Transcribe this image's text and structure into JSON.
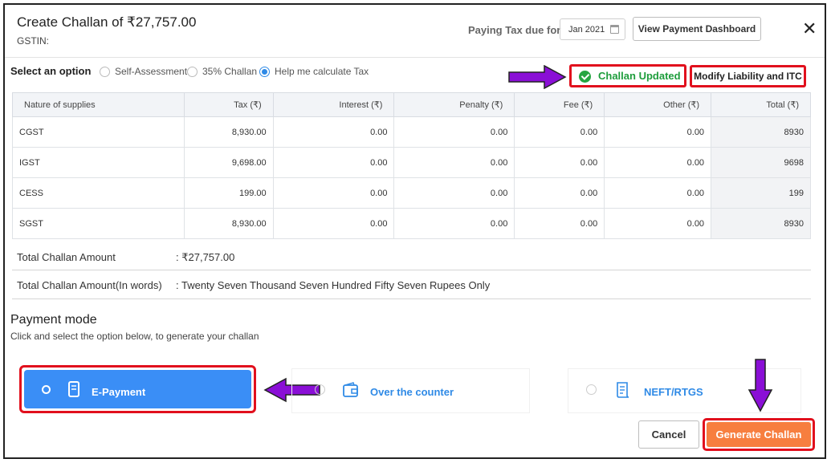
{
  "header": {
    "title": "Create Challan of ₹27,757.00",
    "gstin_label": "GSTIN:",
    "paying_due_label": "Paying Tax due for",
    "period_value": "Jan 2021",
    "view_dashboard_label": "View Payment Dashboard",
    "close_symbol": "✕"
  },
  "options": {
    "label": "Select an option",
    "items": [
      {
        "label": "Self-Assessment",
        "selected": false
      },
      {
        "label": "35% Challan",
        "selected": false
      },
      {
        "label": "Help me calculate Tax",
        "selected": true
      }
    ]
  },
  "status": {
    "updated_label": "Challan Updated",
    "modify_label": "Modify Liability and ITC",
    "success_color": "#1e9d3c"
  },
  "table": {
    "headers": [
      "Nature of supplies",
      "Tax (₹)",
      "Interest (₹)",
      "Penalty (₹)",
      "Fee (₹)",
      "Other (₹)",
      "Total (₹)"
    ],
    "rows": [
      [
        "CGST",
        "8,930.00",
        "0.00",
        "0.00",
        "0.00",
        "0.00",
        "8930"
      ],
      [
        "IGST",
        "9,698.00",
        "0.00",
        "0.00",
        "0.00",
        "0.00",
        "9698"
      ],
      [
        "CESS",
        "199.00",
        "0.00",
        "0.00",
        "0.00",
        "0.00",
        "199"
      ],
      [
        "SGST",
        "8,930.00",
        "0.00",
        "0.00",
        "0.00",
        "0.00",
        "8930"
      ]
    ]
  },
  "summary": {
    "total_label": "Total Challan Amount",
    "total_value": ": ₹27,757.00",
    "words_label": "Total Challan Amount(In words)",
    "words_value": ": Twenty Seven Thousand Seven Hundred Fifty Seven Rupees Only"
  },
  "payment": {
    "title": "Payment mode",
    "subtitle": "Click and select the option below, to generate your challan",
    "modes": [
      {
        "label": "E-Payment",
        "selected": true
      },
      {
        "label": "Over the counter",
        "selected": false
      },
      {
        "label": "NEFT/RTGS",
        "selected": false
      }
    ]
  },
  "footer": {
    "cancel_label": "Cancel",
    "generate_label": "Generate Challan",
    "generate_color": "#f77e3f"
  },
  "annotations": {
    "arrow_color": "#8a0fd6",
    "highlight_color": "#e1101d"
  }
}
